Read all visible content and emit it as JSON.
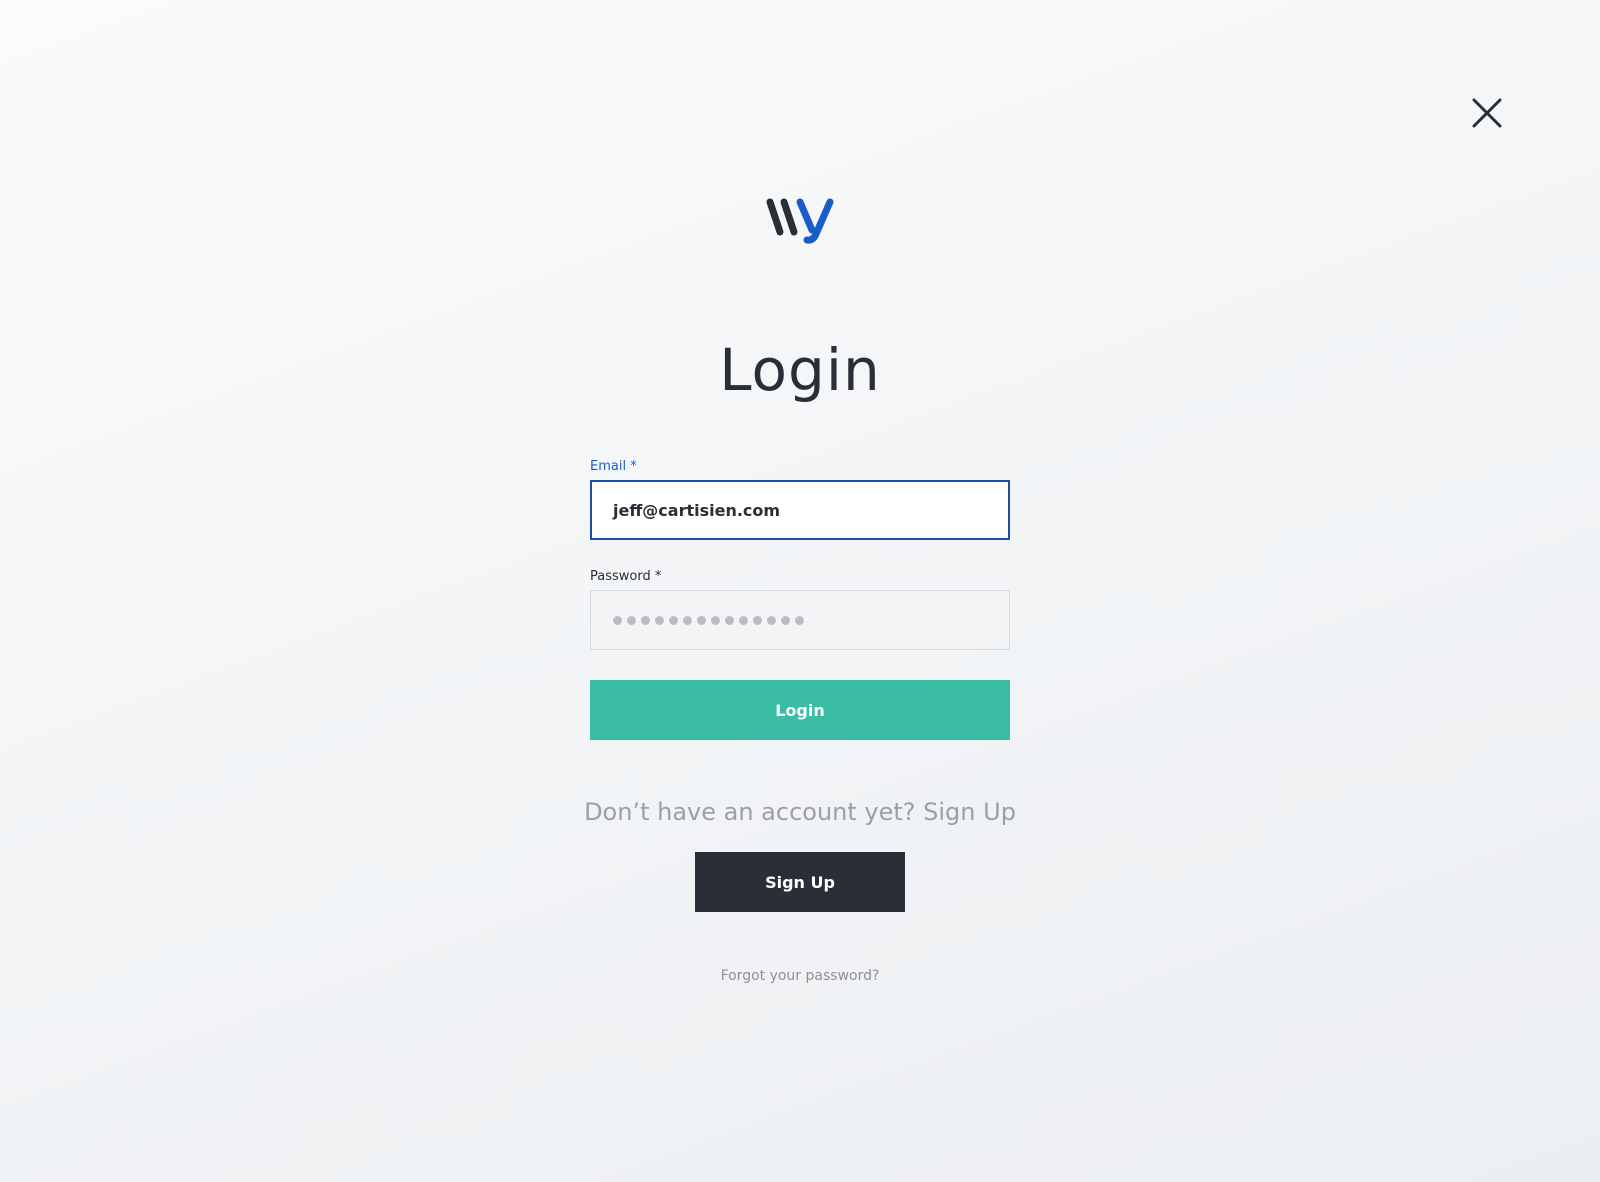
{
  "close": {
    "icon": "close-icon"
  },
  "logo": {
    "icon": "wy-logo",
    "colors": {
      "dark": "#2a2e37",
      "blue": "#1a5cc8"
    }
  },
  "page": {
    "title": "Login"
  },
  "form": {
    "email": {
      "label": "Email *",
      "value": "jeff@cartisien.com"
    },
    "password": {
      "label": "Password *",
      "masked_length": 14
    },
    "login_button": "Login"
  },
  "signup": {
    "prompt": "Don’t have an account yet? Sign Up",
    "button": "Sign Up"
  },
  "forgot": {
    "link": "Forgot your password?"
  },
  "colors": {
    "accent_green": "#3bbca5",
    "focus_blue": "#1a4ea8",
    "dark": "#2a2e37",
    "muted_text": "#9c9fa5"
  }
}
